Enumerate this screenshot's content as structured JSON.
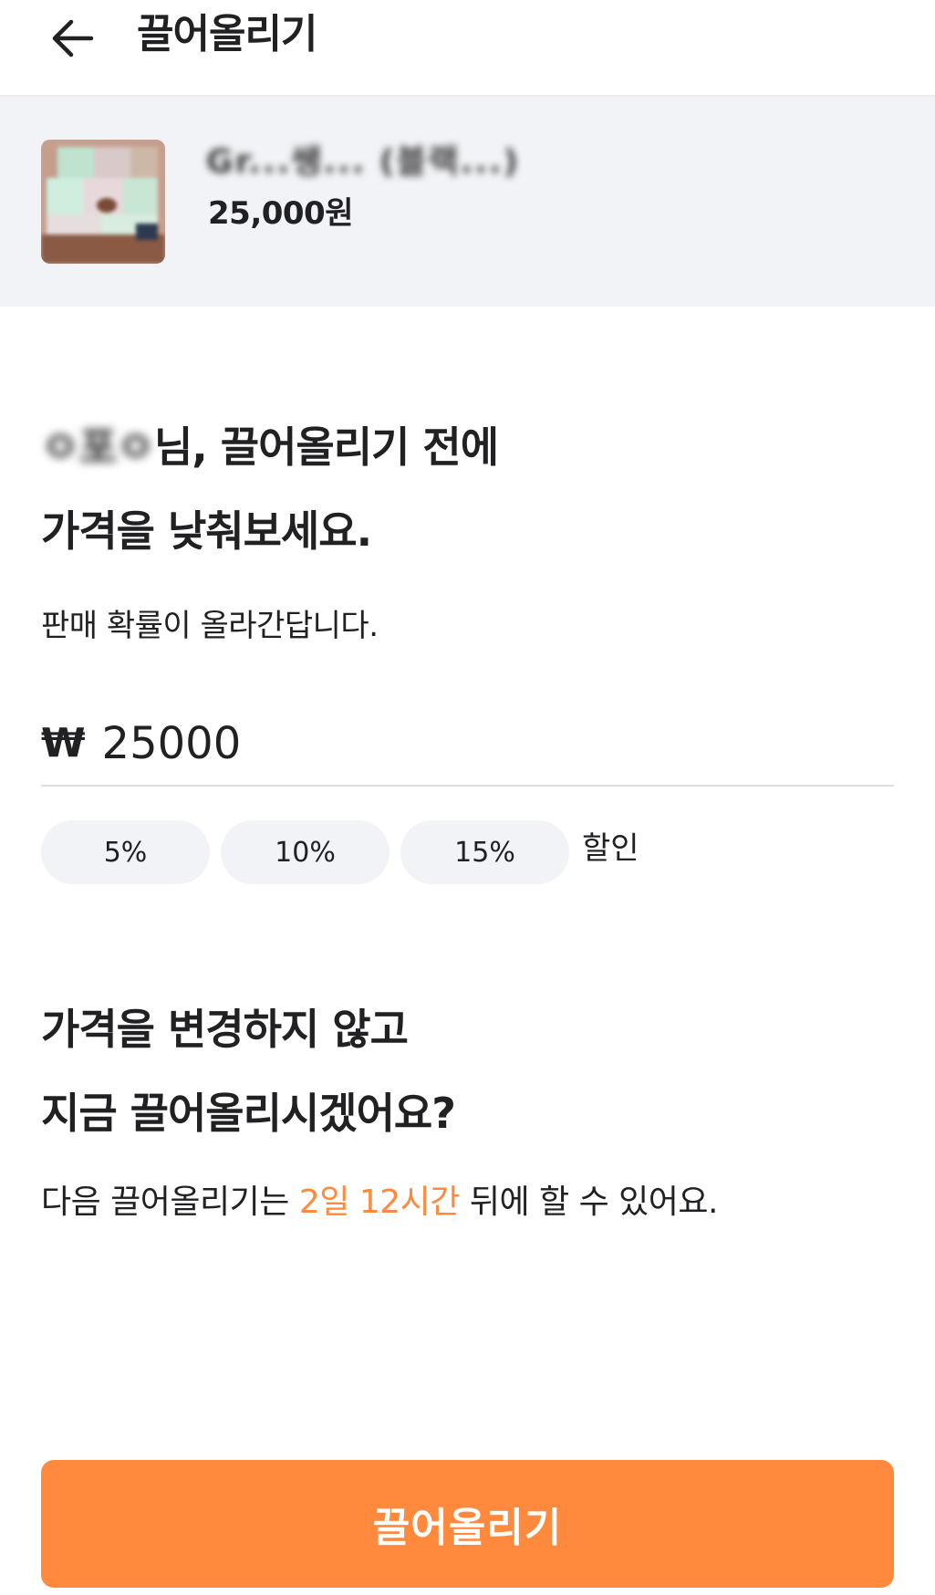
{
  "header": {
    "title": "끌어올리기",
    "back_icon": "arrow-left-icon"
  },
  "product": {
    "name": "Gr...쌩... (블랙...)",
    "price": "25,000원"
  },
  "discount_section": {
    "user_name": "ㅇ포ㅇ",
    "line1_suffix": "님, 끌어올리기 전에",
    "line2": "가격을 낮춰보세요.",
    "sub_text": "판매 확률이 올라간답니다.",
    "currency_symbol": "₩",
    "price_value": "25000",
    "chips": [
      "5%",
      "10%",
      "15%"
    ],
    "chip_suffix": "할인"
  },
  "bump_section": {
    "line1": "가격을 변경하지 않고",
    "line2": "지금 끌어올리시겠어요?",
    "note_prefix": "다음 끌어올리기는 ",
    "note_highlight": "2일 12시간",
    "note_suffix": " 뒤에 할 수 있어요.",
    "accent_color": "#ff8a3d"
  },
  "cta": {
    "label": "끌어올리기",
    "color": "#ff8a3d"
  }
}
